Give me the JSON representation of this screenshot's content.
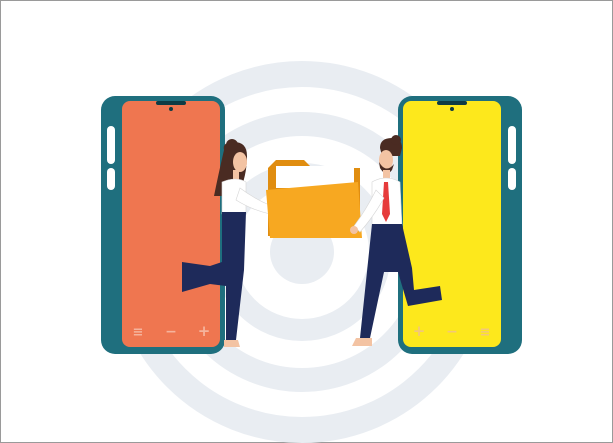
{
  "illustration": {
    "colors": {
      "background": "#ffffff",
      "frame_border": "#9a9a9a",
      "ring": "#e9edf2",
      "phone_body": "#1f6f7e",
      "left_screen": "#ef7650",
      "right_screen": "#fde81c",
      "folder_front": "#f7a821",
      "folder_back": "#e08d10",
      "paper": "#ffffff",
      "trousers": "#1e2a5a",
      "shirt": "#ffffff",
      "tie": "#e63b3b",
      "skin": "#f3c3a3",
      "hair": "#4a2b22"
    },
    "icons": [
      "phone-left",
      "phone-right",
      "folder-icon",
      "woman-figure",
      "man-figure",
      "target-rings"
    ],
    "left_phone": {
      "controls": [
        "≡",
        "−",
        "+"
      ]
    },
    "right_phone": {
      "controls": [
        "+",
        "−",
        "≡"
      ]
    }
  }
}
